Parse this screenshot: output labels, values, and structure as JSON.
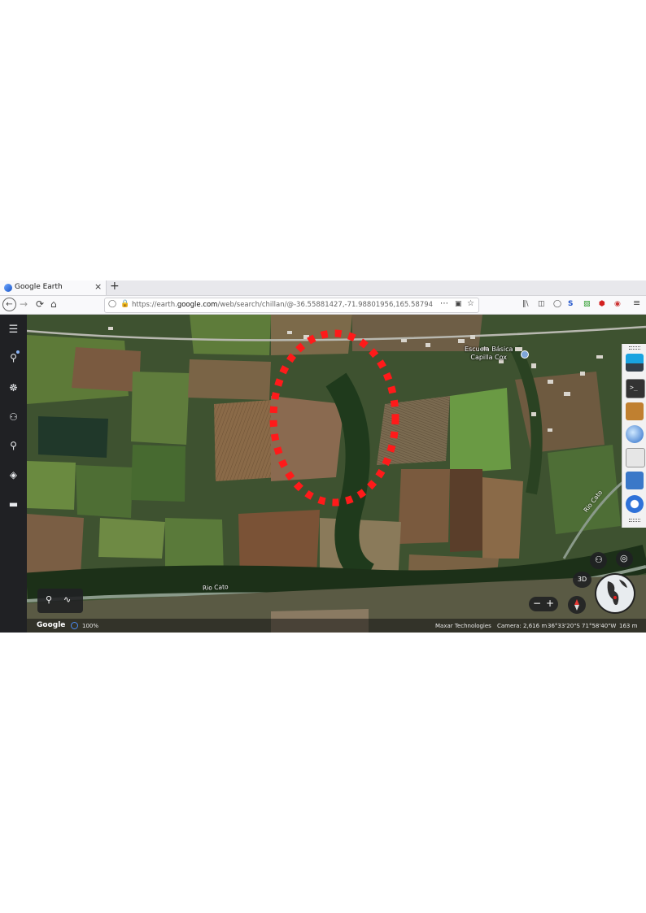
{
  "browser": {
    "tab_title": "Google Earth",
    "tab_close": "×",
    "new_tab": "+",
    "url_host": "https://earth.",
    "url_domain": "google.com",
    "url_path": "/web/search/chillan/@-36.55881427,-71.98801956,165.58794659",
    "url_more": "⋯",
    "menu": "≡"
  },
  "sidebar": {
    "items": [
      "menu-icon",
      "search-icon",
      "voyager-icon",
      "feeling-lucky-icon",
      "projects-icon",
      "map-style-icon",
      "measure-icon"
    ]
  },
  "map": {
    "labels": {
      "school_line1": "Escuela Básica",
      "school_line2": "Capilla Cox",
      "river_west": "Rio Cato",
      "river_east": "Rio Cato"
    },
    "annotation_color": "#ff1a1a"
  },
  "controls": {
    "three_d": "3D",
    "zoom_out": "−",
    "zoom_in": "+"
  },
  "status_bar": {
    "logo": "Google",
    "progress": "100%",
    "attribution": "Maxar Technologies",
    "camera": "Camera: 2,616 m",
    "coordinates": "36°33'20\"S 71°58'40\"W",
    "scale": "163 m"
  }
}
